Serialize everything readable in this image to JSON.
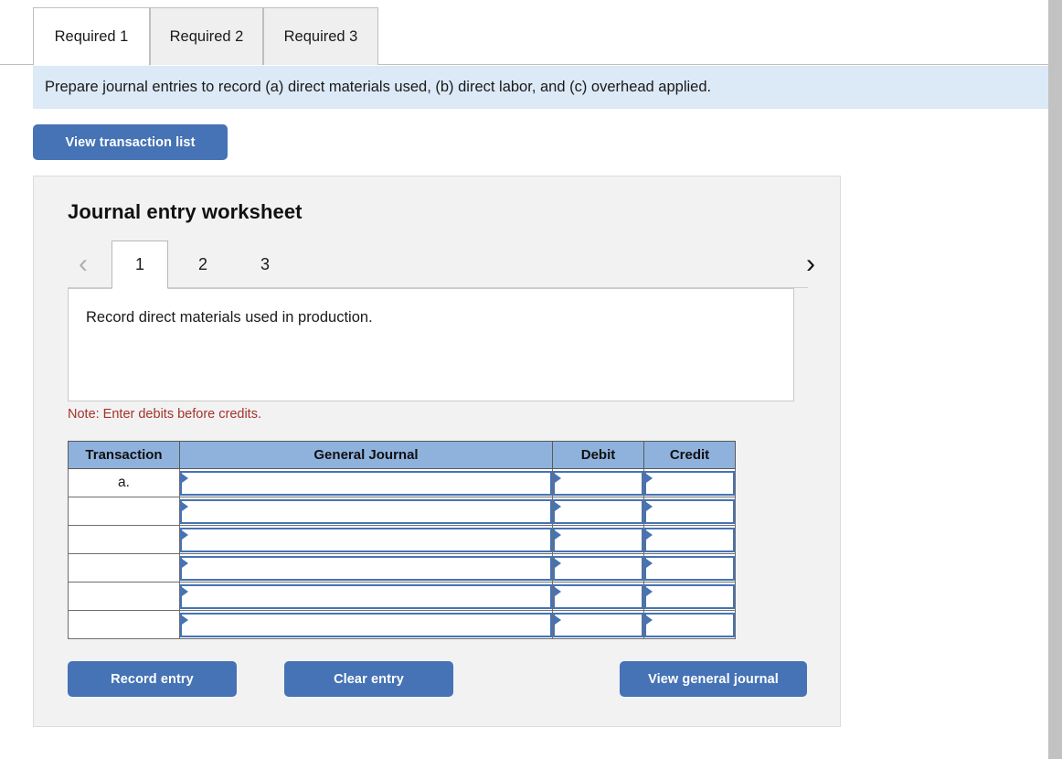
{
  "tabs": [
    {
      "label": "Required 1",
      "active": true
    },
    {
      "label": "Required 2",
      "active": false
    },
    {
      "label": "Required 3",
      "active": false
    }
  ],
  "banner": {
    "text": "Prepare journal entries to record (a) direct materials used, (b) direct labor, and (c) overhead applied."
  },
  "toolbar": {
    "view_transaction_list_label": "View transaction list"
  },
  "worksheet": {
    "title": "Journal entry worksheet",
    "pager": {
      "prev_icon": "chevron-left-icon",
      "next_icon": "chevron-right-icon",
      "prev_glyph": "‹",
      "next_glyph": "›",
      "pages": [
        {
          "label": "1",
          "active": true
        },
        {
          "label": "2",
          "active": false
        },
        {
          "label": "3",
          "active": false
        }
      ]
    },
    "description": "Record direct materials used in production.",
    "note": "Note: Enter debits before credits.",
    "table": {
      "headers": [
        "Transaction",
        "General Journal",
        "Debit",
        "Credit"
      ],
      "rows": [
        {
          "transaction": "a.",
          "general_journal": "",
          "debit": "",
          "credit": ""
        },
        {
          "transaction": "",
          "general_journal": "",
          "debit": "",
          "credit": ""
        },
        {
          "transaction": "",
          "general_journal": "",
          "debit": "",
          "credit": ""
        },
        {
          "transaction": "",
          "general_journal": "",
          "debit": "",
          "credit": ""
        },
        {
          "transaction": "",
          "general_journal": "",
          "debit": "",
          "credit": ""
        },
        {
          "transaction": "",
          "general_journal": "",
          "debit": "",
          "credit": ""
        }
      ]
    },
    "actions": {
      "record_entry_label": "Record entry",
      "clear_entry_label": "Clear entry",
      "view_general_journal_label": "View general journal"
    }
  },
  "colors": {
    "button_blue": "#4573b5",
    "header_blue": "#8fb2dd",
    "banner_blue": "#dce9f6",
    "panel_gray": "#f2f2f2",
    "note_red": "#a3342c"
  }
}
